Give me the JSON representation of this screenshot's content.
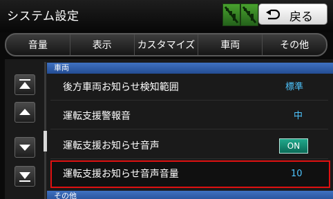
{
  "header": {
    "title": "システム設定",
    "back_label": "戻る",
    "status_icons": [
      "signal-off-icon",
      "signal-off-icon"
    ]
  },
  "tabs": [
    {
      "label": "音量"
    },
    {
      "label": "表示"
    },
    {
      "label": "カスタマイズ"
    },
    {
      "label": "車両"
    },
    {
      "label": "その他"
    }
  ],
  "list": {
    "section_current": "車両",
    "section_next": "その他",
    "rows": [
      {
        "label": "後方車両お知らせ検知範囲",
        "value": "標準"
      },
      {
        "label": "運転支援警報音",
        "value": "中"
      },
      {
        "label": "運転支援お知らせ音声",
        "value": "ON"
      },
      {
        "label": "運転支援お知らせ音声音量",
        "value": "10"
      }
    ],
    "selected_index": 3
  },
  "scroll_buttons": [
    "scroll-top",
    "scroll-up",
    "scroll-down",
    "scroll-bottom"
  ],
  "colors": {
    "accent_blue": "#4ec5ff",
    "section_blue": "#3f71c1",
    "selection_red": "#e01010",
    "toggle_on": "#1a9a80"
  }
}
